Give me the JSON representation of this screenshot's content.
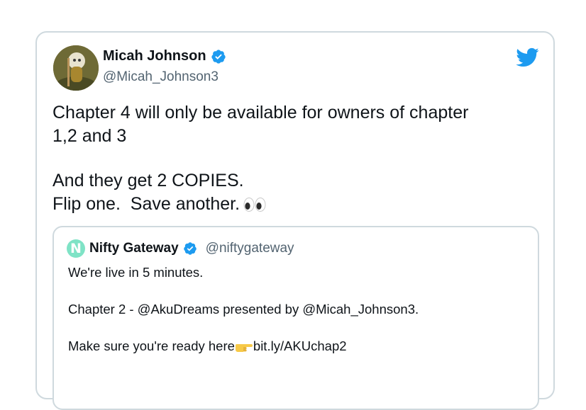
{
  "tweet": {
    "author_name": "Micah Johnson",
    "author_handle": "@Micah_Johnson3",
    "avatar_icon": "avatar-image",
    "verified_icon": "verified-badge-icon",
    "brand_icon": "twitter-bird-icon",
    "brand_color": "#1d9bf0",
    "body_lines": [
      "Chapter 4 will only be available for owners of chapter",
      "1,2 and 3",
      "",
      "And they get 2 COPIES.",
      "Flip one.  Save another."
    ],
    "body_trailing_emoji": "eyes-icon"
  },
  "quoted_tweet": {
    "author_name": "Nifty Gateway",
    "author_handle": "@niftygateway",
    "avatar_letter": "N",
    "avatar_color": "#7fe3c6",
    "verified_icon": "verified-badge-icon",
    "body_lines": [
      "We're live in 5 minutes.",
      "",
      "Chapter 2 - @AkuDreams presented by @Micah_Johnson3.",
      "",
      "Make sure you're ready here"
    ],
    "link_text": "bit.ly/AKUchap2",
    "link_emoji": "pointing-hand-icon"
  }
}
